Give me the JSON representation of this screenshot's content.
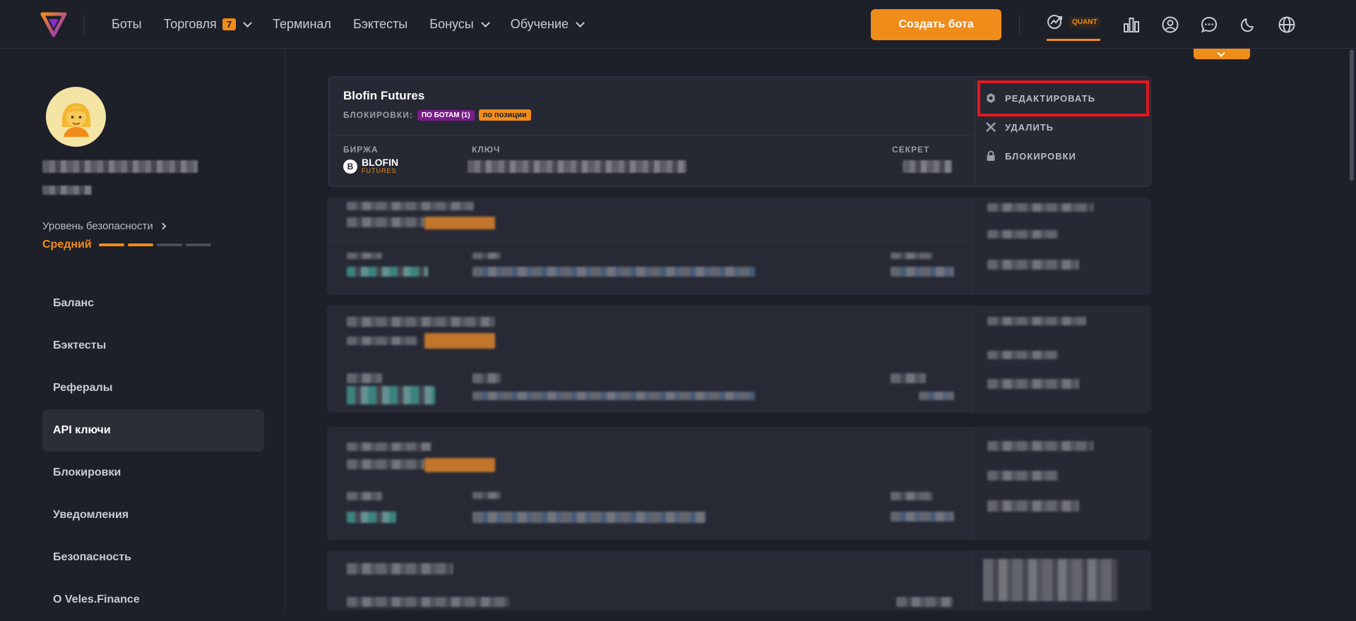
{
  "nav": {
    "items": [
      {
        "label": "Боты"
      },
      {
        "label": "Торговля",
        "badge": "7"
      },
      {
        "label": "Терминал"
      },
      {
        "label": "Бэктесты"
      },
      {
        "label": "Бонусы"
      },
      {
        "label": "Обучение"
      }
    ],
    "create_bot": "Создать бота",
    "quant_label": "QUANT"
  },
  "sidebar": {
    "security_link": "Уровень безопасности",
    "security_level": "Средний",
    "menu": [
      {
        "label": "Баланс"
      },
      {
        "label": "Бэктесты"
      },
      {
        "label": "Рефералы"
      },
      {
        "label": "API ключи"
      },
      {
        "label": "Блокировки"
      },
      {
        "label": "Уведомления"
      },
      {
        "label": "Безопасность"
      },
      {
        "label": "О Veles.Finance"
      }
    ]
  },
  "card": {
    "title": "Blofin Futures",
    "locks_label": "БЛОКИРОВКИ:",
    "tag_bots": "ПО БОТАМ (1)",
    "tag_position": "по позиции",
    "col_exchange": "БИРЖА",
    "col_key": "КЛЮЧ",
    "col_secret": "СЕКРЕТ",
    "exchange_name": "BLOFIN",
    "exchange_sub": "FUTURES",
    "actions": {
      "edit": "РЕДАКТИРОВАТЬ",
      "delete": "УДАЛИТЬ",
      "locks": "БЛОКИРОВКИ"
    }
  },
  "colors": {
    "accent": "#f08c1a",
    "highlight": "#e4161f",
    "tag_purple": "#7a1c8a"
  }
}
